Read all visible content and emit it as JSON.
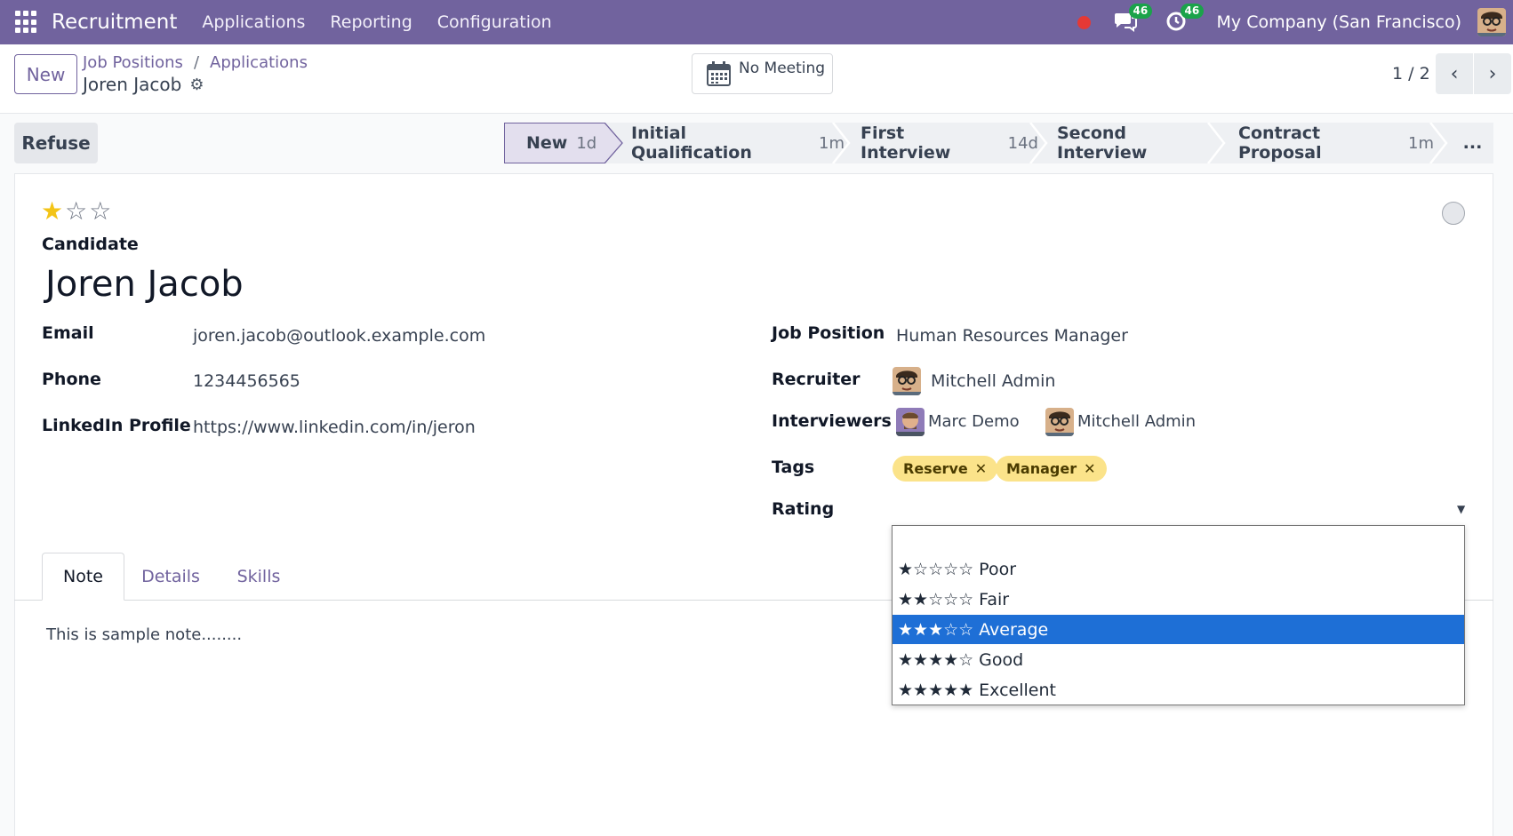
{
  "topbar": {
    "app_title": "Recruitment",
    "menu": [
      "Applications",
      "Reporting",
      "Configuration"
    ],
    "messages_count": "46",
    "activities_count": "46",
    "company": "My Company (San Francisco)"
  },
  "control": {
    "new_label": "New",
    "breadcrumb": [
      "Job Positions",
      "Applications"
    ],
    "record_title": "Joren Jacob",
    "meeting_label": "No Meeting",
    "pager": "1 / 2"
  },
  "statusbar": {
    "refuse_label": "Refuse",
    "stages": [
      {
        "name": "New",
        "duration": "1d"
      },
      {
        "name": "Initial Qualification",
        "duration": "1m"
      },
      {
        "name": "First Interview",
        "duration": "14d"
      },
      {
        "name": "Second Interview",
        "duration": ""
      },
      {
        "name": "Contract Proposal",
        "duration": "1m"
      }
    ],
    "more_label": "..."
  },
  "form": {
    "priority_stars": 1,
    "priority_max": 3,
    "candidate_label": "Candidate",
    "candidate_name": "Joren Jacob",
    "email_label": "Email",
    "email": "joren.jacob@outlook.example.com",
    "phone_label": "Phone",
    "phone": "1234456565",
    "linkedin_label": "LinkedIn Profile",
    "linkedin": "https://www.linkedin.com/in/jeron",
    "job_position_label": "Job Position",
    "job_position": "Human Resources Manager",
    "recruiter_label": "Recruiter",
    "recruiter": "Mitchell Admin",
    "interviewers_label": "Interviewers",
    "interviewers": [
      "Marc Demo",
      "Mitchell Admin"
    ],
    "tags_label": "Tags",
    "tags": [
      "Reserve",
      "Manager"
    ],
    "rating_label": "Rating"
  },
  "tabs": {
    "items": [
      "Note",
      "Details",
      "Skills"
    ],
    "active": "Note",
    "note_text": "This is sample note........"
  },
  "rating_dropdown": {
    "options": [
      {
        "stars": "",
        "label": ""
      },
      {
        "stars": "★☆☆☆☆",
        "label": "Poor"
      },
      {
        "stars": "★★☆☆☆",
        "label": "Fair"
      },
      {
        "stars": "★★★☆☆",
        "label": "Average"
      },
      {
        "stars": "★★★★☆",
        "label": "Good"
      },
      {
        "stars": "★★★★★",
        "label": "Excellent"
      }
    ],
    "selected": "Average"
  },
  "colors": {
    "brand": "#71639e",
    "selected_option": "#1e6fd6",
    "tag_bg": "#fbe38a",
    "star": "#f3c417",
    "badge": "#1aa34a"
  }
}
